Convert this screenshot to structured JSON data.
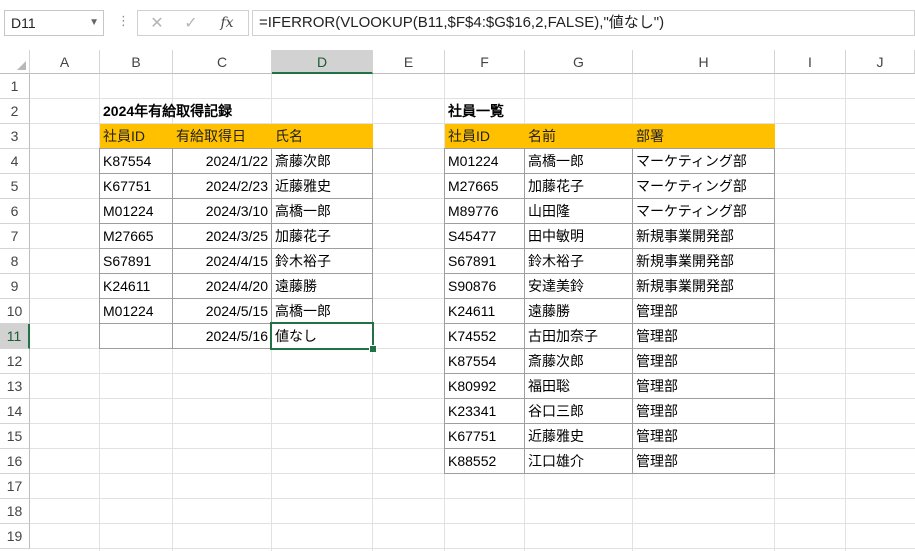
{
  "name_box": "D11",
  "formula_bar": {
    "cancel_icon": "✕",
    "enter_icon": "✓",
    "fx_label": "fx",
    "formula": "=IFERROR(VLOOKUP(B11,$F$4:$G$16,2,FALSE),\"値なし\")"
  },
  "columns": [
    "A",
    "B",
    "C",
    "D",
    "E",
    "F",
    "G",
    "H",
    "I",
    "J"
  ],
  "rows": [
    "1",
    "2",
    "3",
    "4",
    "5",
    "6",
    "7",
    "8",
    "9",
    "10",
    "11",
    "12",
    "13",
    "14",
    "15",
    "16",
    "17",
    "18",
    "19"
  ],
  "left_table": {
    "title": "2024年有給取得記録",
    "headers": [
      "社員ID",
      "有給取得日",
      "氏名"
    ],
    "rows": [
      [
        "K87554",
        "2024/1/22",
        "斎藤次郎"
      ],
      [
        "K67751",
        "2024/2/23",
        "近藤雅史"
      ],
      [
        "M01224",
        "2024/3/10",
        "高橋一郎"
      ],
      [
        "M27665",
        "2024/3/25",
        "加藤花子"
      ],
      [
        "S67891",
        "2024/4/15",
        "鈴木裕子"
      ],
      [
        "K24611",
        "2024/4/20",
        "遠藤勝"
      ],
      [
        "M01224",
        "2024/5/15",
        "高橋一郎"
      ],
      [
        "",
        "2024/5/16",
        "値なし"
      ]
    ]
  },
  "right_table": {
    "title": "社員一覧",
    "headers": [
      "社員ID",
      "名前",
      "部署"
    ],
    "rows": [
      [
        "M01224",
        "高橋一郎",
        "マーケティング部"
      ],
      [
        "M27665",
        "加藤花子",
        "マーケティング部"
      ],
      [
        "M89776",
        "山田隆",
        "マーケティング部"
      ],
      [
        "S45477",
        "田中敏明",
        "新規事業開発部"
      ],
      [
        "S67891",
        "鈴木裕子",
        "新規事業開発部"
      ],
      [
        "S90876",
        "安達美鈴",
        "新規事業開発部"
      ],
      [
        "K24611",
        "遠藤勝",
        "管理部"
      ],
      [
        "K74552",
        "古田加奈子",
        "管理部"
      ],
      [
        "K87554",
        "斎藤次郎",
        "管理部"
      ],
      [
        "K80992",
        "福田聡",
        "管理部"
      ],
      [
        "K23341",
        "谷口三郎",
        "管理部"
      ],
      [
        "K67751",
        "近藤雅史",
        "管理部"
      ],
      [
        "K88552",
        "江口雄介",
        "管理部"
      ]
    ]
  },
  "selected_cell": "D11",
  "colors": {
    "header_fill": "#ffc000",
    "selection": "#217346"
  }
}
